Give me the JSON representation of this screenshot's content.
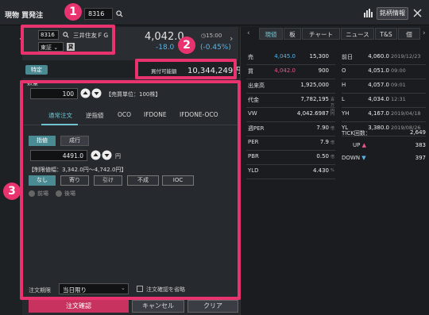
{
  "title_bar": {
    "title": "現物 買発注",
    "code": "8316",
    "brand_info_label": "銘柄情報"
  },
  "stock": {
    "code": "8316",
    "name": "三井住友ＦＧ",
    "market": "東証",
    "market_badge": "貸",
    "price": "4,042.0",
    "price_time": "15:00",
    "change": "-18.0",
    "change_pct": "(-0.45%)"
  },
  "account": {
    "type_label": "特定",
    "buying_power_label": "買付可能額",
    "buying_power_value": "10,344,249円"
  },
  "order": {
    "qty_label": "数量",
    "qty_value": "100",
    "unit_text": "【売買単位：100株】",
    "tabs": [
      "通常注文",
      "逆指値",
      "OCO",
      "IFDONE",
      "IFDONE-OCO"
    ],
    "price_types": [
      "指値",
      "成行"
    ],
    "price_value": "4491.0",
    "price_unit": "円",
    "limit_range": "【制限値幅：3,342.0円～4,742.0円】",
    "conditions": [
      "なし",
      "寄り",
      "引け",
      "不成",
      "IOC"
    ],
    "session_options": [
      "前場",
      "後場"
    ],
    "expiry_label": "注文期限",
    "expiry_value": "当日限り",
    "confirm_skip_label": "注文確認を省略",
    "submit_label": "注文確認",
    "cancel_label": "キャンセル",
    "clear_label": "クリア"
  },
  "right_tabs": [
    "現値",
    "板",
    "チャート",
    "ニュース",
    "T&S",
    "個"
  ],
  "quote_rows": [
    {
      "label": "売",
      "price": "4,045.0",
      "volume": "15,300",
      "color": "#5ab4e6"
    },
    {
      "label": "買",
      "price": "4,042.0",
      "volume": "900",
      "color": "#e8588a"
    },
    {
      "label": "出来高",
      "price": "",
      "volume": "1,925,000",
      "unit": ""
    },
    {
      "label": "代金",
      "price": "",
      "volume": "7,782,195",
      "unit": "百万円"
    },
    {
      "label": "VW",
      "price": "",
      "volume": "4,042.6987",
      "unit": "円"
    },
    {
      "label": "週PER",
      "price": "",
      "volume": "7.90",
      "unit": "倍"
    },
    {
      "label": "PER",
      "price": "",
      "volume": "7.9",
      "unit": "倍"
    },
    {
      "label": "PBR",
      "price": "",
      "volume": "0.50",
      "unit": "倍"
    },
    {
      "label": "YLD",
      "price": "",
      "volume": "4.430",
      "unit": "%"
    }
  ],
  "info_rows": [
    {
      "label": "前日",
      "value": "4,060.0",
      "date": "2019/12/23"
    },
    {
      "label": "O",
      "value": "4,051.0",
      "date": "09:00"
    },
    {
      "label": "H",
      "value": "4,057.0",
      "date": "09:01"
    },
    {
      "label": "L",
      "value": "4,034.0",
      "date": "12:31"
    },
    {
      "label": "YH",
      "value": "4,167.0",
      "date": "2019/04/18"
    },
    {
      "label": "YL",
      "value": "3,380.0",
      "date": "2019/08/26"
    }
  ],
  "tick": {
    "label": "TICK回数：",
    "count": "2,649",
    "up_label": "UP",
    "up_value": "383",
    "down_label": "DOWN",
    "down_value": "397"
  },
  "annotations": [
    "1",
    "2",
    "3"
  ],
  "colors": {
    "accent": "#e8336f",
    "teal": "#4a8a92",
    "down_blue": "#5ab4e6"
  }
}
